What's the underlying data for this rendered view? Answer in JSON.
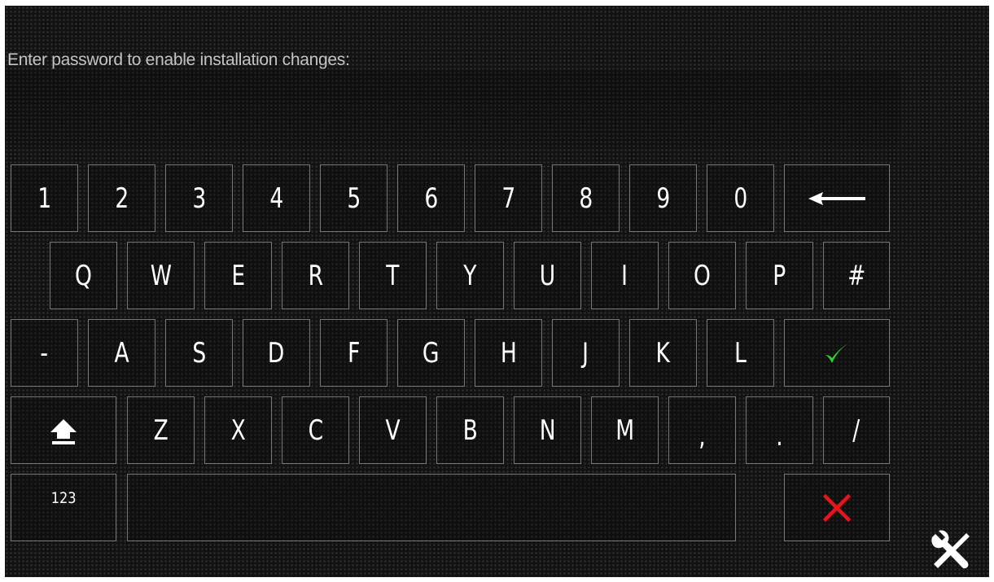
{
  "prompt": "Enter password to enable installation changes:",
  "keyboard": {
    "row1": [
      "1",
      "2",
      "3",
      "4",
      "5",
      "6",
      "7",
      "8",
      "9",
      "0"
    ],
    "row2": [
      "Q",
      "W",
      "E",
      "R",
      "T",
      "Y",
      "U",
      "I",
      "O",
      "P",
      "#"
    ],
    "row3": [
      "-",
      "A",
      "S",
      "D",
      "F",
      "G",
      "H",
      "J",
      "K",
      "L"
    ],
    "row4": [
      "Z",
      "X",
      "C",
      "V",
      "B",
      "N",
      "M"
    ],
    "comma": ",",
    "period": ".",
    "slash": "/",
    "numbers_toggle": "123"
  },
  "icons": {
    "backspace": "left-arrow-icon",
    "confirm": "checkmark-icon",
    "shift": "shift-arrow-icon",
    "cancel": "x-icon",
    "tools": "wrench-screwdriver-icon"
  },
  "colors": {
    "confirm": "#2fd12f",
    "cancel": "#e8141a",
    "key_border": "#767676",
    "prompt_text": "#c4c4c4"
  }
}
